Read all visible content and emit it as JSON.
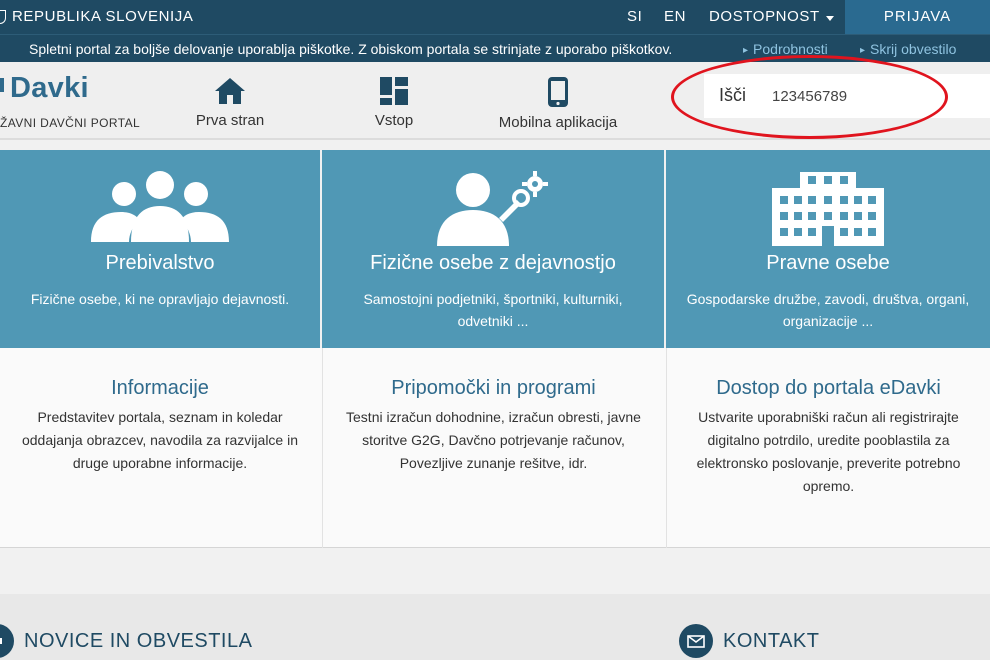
{
  "topbar": {
    "country": "REPUBLIKA SLOVENIJA",
    "lang_si": "SI",
    "lang_en": "EN",
    "accessibility": "DOSTOPNOST",
    "login": "PRIJAVA"
  },
  "cookie": {
    "message": "Spletni portal za boljše delovanje uporablja piškotke. Z obiskom portala se strinjate z uporabo piškotkov.",
    "details": "Podrobnosti",
    "hide": "Skrij obvestilo"
  },
  "header": {
    "logo_name": "Davki",
    "logo_sub": "ŽAVNI DAVČNI PORTAL",
    "nav": [
      {
        "label": "Prva stran",
        "icon": "home-icon"
      },
      {
        "label": "Vstop",
        "icon": "grid-icon"
      },
      {
        "label": "Mobilna aplikacija",
        "icon": "mobile-phone-icon"
      }
    ],
    "search_label": "Išči",
    "search_value": "123456789"
  },
  "cards": [
    {
      "title": "Prebivalstvo",
      "desc": "Fizične osebe, ki ne opravljajo dejavnosti.",
      "icon": "people-group-icon"
    },
    {
      "title": "Fizične osebe z dejavnostjo",
      "desc": "Samostojni podjetniki, športniki, kulturniki, odvetniki ...",
      "icon": "person-tools-icon"
    },
    {
      "title": "Pravne osebe",
      "desc": "Gospodarske družbe, zavodi, društva, organi, organizacije ...",
      "icon": "building-icon"
    }
  ],
  "info": [
    {
      "title": "Informacije",
      "text": "Predstavitev portala, seznam in koledar oddajanja obrazcev, navodila za razvijalce in druge uporabne informacije."
    },
    {
      "title": "Pripomočki in programi",
      "text": "Testni izračun dohodnine, izračun obresti, javne storitve G2G, Davčno potrjevanje računov, Povezljive zunanje rešitve, idr."
    },
    {
      "title": "Dostop do portala eDavki",
      "text": "Ustvarite uporabniški račun ali registrirajte digitalno potrdilo, uredite pooblastila za elektronsko poslovanje, preverite potrebno opremo."
    }
  ],
  "sections": {
    "news": "NOVICE IN OBVESTILA",
    "contact": "KONTAKT"
  },
  "colors": {
    "topbar": "#1f4a63",
    "login": "#2a6a90",
    "card": "#5098b5",
    "link": "#2f6a8c",
    "highlight": "#e0141e"
  }
}
